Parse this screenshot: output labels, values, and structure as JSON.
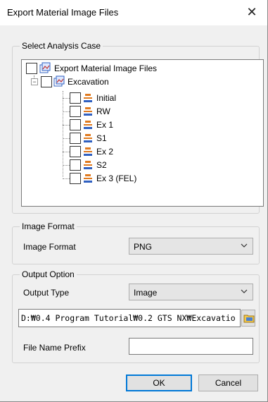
{
  "window": {
    "title": "Export Material Image Files",
    "close_label": "✕"
  },
  "analysis_case": {
    "legend": "Select Analysis Case",
    "root_label": "Export Material Image Files",
    "stage_group_label": "Excavation",
    "stages": [
      "Initial",
      "RW",
      "Ex 1",
      "S1",
      "Ex 2",
      "S2",
      "Ex 3 (FEL)"
    ]
  },
  "image_format": {
    "legend": "Image Format",
    "label": "Image Format",
    "value": "PNG"
  },
  "output_option": {
    "legend": "Output Option",
    "output_type_label": "Output Type",
    "output_type_value": "Image",
    "path": "D:₩0.4 Program Tutorial₩0.2 GTS NX₩Excavatio",
    "prefix_label": "File Name Prefix",
    "prefix_value": ""
  },
  "buttons": {
    "ok": "OK",
    "cancel": "Cancel"
  },
  "colors": {
    "accent": "#0078d7",
    "stage_icon": "#e07a1f",
    "tree_icon": "#3060c0"
  }
}
